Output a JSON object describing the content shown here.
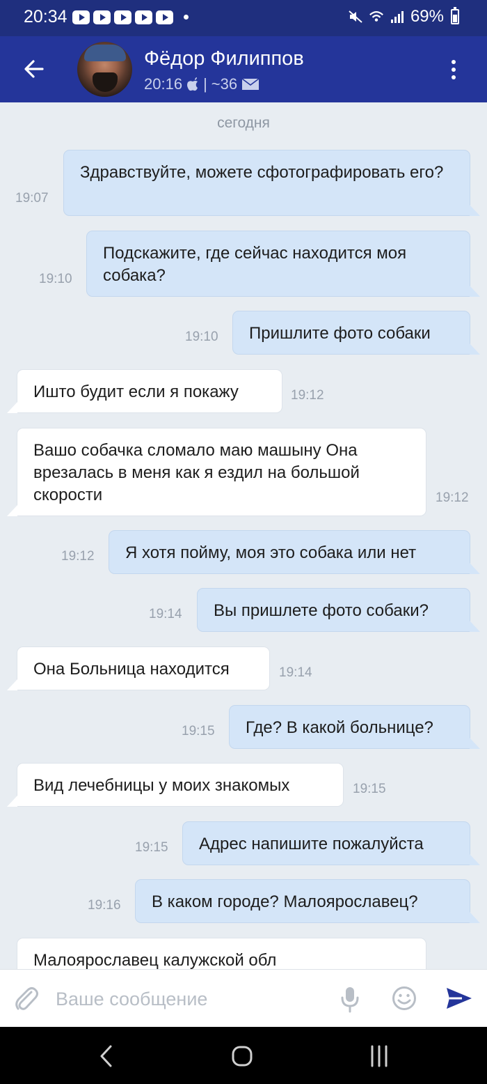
{
  "status_bar": {
    "time": "20:34",
    "battery": "69%"
  },
  "header": {
    "name": "Фёдор Филиппов",
    "last_seen": "20:16",
    "message_count": "~36",
    "colors": {
      "header_bg": "#24359a",
      "status_bg": "#1f2f7e"
    }
  },
  "chat": {
    "date_separator": "сегодня",
    "messages": [
      {
        "dir": "out",
        "time": "19:07",
        "text": "Здравствуйте, можете сфотографировать его?"
      },
      {
        "dir": "out",
        "time": "19:10",
        "text": "Подскажите, где сейчас находится моя собака?"
      },
      {
        "dir": "out",
        "time": "19:10",
        "text": "Пришлите фото собаки"
      },
      {
        "dir": "in",
        "time": "19:12",
        "text": "Ишто будит если я покажу"
      },
      {
        "dir": "in",
        "time": "19:12",
        "text": "Вашо собачка сломало маю машыну Она врезалась в меня как я ездил на большой скорости"
      },
      {
        "dir": "out",
        "time": "19:12",
        "text": "Я хотя пойму, моя это собака или нет"
      },
      {
        "dir": "out",
        "time": "19:14",
        "text": "Вы пришлете фото собаки?"
      },
      {
        "dir": "in",
        "time": "19:14",
        "text": "Она Больница находится"
      },
      {
        "dir": "out",
        "time": "19:15",
        "text": "Где? В какой больнице?"
      },
      {
        "dir": "in",
        "time": "19:15",
        "text": "Вид лечебницы у моих знакомых"
      },
      {
        "dir": "out",
        "time": "19:15",
        "text": "Адрес напишите пожалуйста"
      },
      {
        "dir": "out",
        "time": "19:16",
        "text": "В каком городе? Малоярославец?"
      },
      {
        "dir": "in",
        "time": "",
        "text": "Малоярославец калужской обл"
      }
    ],
    "colors": {
      "outgoing_bubble": "#d4e5f8",
      "incoming_bubble": "#ffffff",
      "background": "#e8edf2"
    }
  },
  "composer": {
    "placeholder": "Ваше сообщение",
    "value": ""
  },
  "icons": {
    "header": [
      "back-arrow-icon",
      "apple-icon",
      "mail-icon",
      "more-vertical-icon"
    ],
    "composer": [
      "paperclip-icon",
      "microphone-icon",
      "emoji-icon",
      "send-icon"
    ],
    "navigation": [
      "nav-back-icon",
      "nav-home-icon",
      "nav-recents-icon"
    ]
  }
}
